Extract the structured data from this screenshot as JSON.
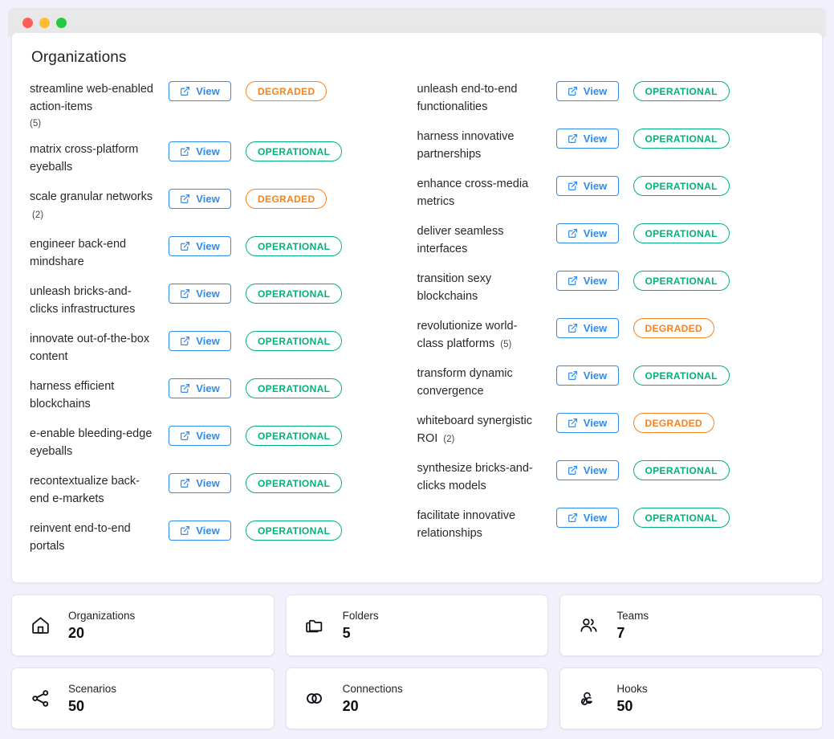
{
  "window": {
    "controls": [
      {
        "name": "close",
        "color": "#ff5f57"
      },
      {
        "name": "minimize",
        "color": "#febc2e"
      },
      {
        "name": "maximize",
        "color": "#28c840"
      }
    ]
  },
  "panel": {
    "title": "Organizations",
    "view_label": "View",
    "view_icon": "external-link-icon",
    "status_colors": {
      "operational": "#00b377",
      "degraded": "#f7821b"
    },
    "columns": [
      {
        "rows": [
          {
            "name": "streamline web-enabled action-items",
            "count": "(5)",
            "count_block": true,
            "status": "DEGRADED",
            "status_kind": "degraded"
          },
          {
            "name": "matrix cross-platform eyeballs",
            "count": "",
            "status": "OPERATIONAL",
            "status_kind": "operational"
          },
          {
            "name": "scale granular networks",
            "count": "(2)",
            "status": "DEGRADED",
            "status_kind": "degraded"
          },
          {
            "name": "engineer back-end mindshare",
            "count": "",
            "status": "OPERATIONAL",
            "status_kind": "operational"
          },
          {
            "name": "unleash bricks-and-clicks infrastructures",
            "count": "",
            "status": "OPERATIONAL",
            "status_kind": "operational"
          },
          {
            "name": "innovate out-of-the-box content",
            "count": "",
            "status": "OPERATIONAL",
            "status_kind": "operational"
          },
          {
            "name": "harness efficient blockchains",
            "count": "",
            "status": "OPERATIONAL",
            "status_kind": "operational"
          },
          {
            "name": "e-enable bleeding-edge eyeballs",
            "count": "",
            "status": "OPERATIONAL",
            "status_kind": "operational"
          },
          {
            "name": "recontextualize back-end e-markets",
            "count": "",
            "status": "OPERATIONAL",
            "status_kind": "operational"
          },
          {
            "name": "reinvent end-to-end portals",
            "count": "",
            "status": "OPERATIONAL",
            "status_kind": "operational"
          }
        ]
      },
      {
        "rows": [
          {
            "name": "unleash end-to-end functionalities",
            "count": "",
            "status": "OPERATIONAL",
            "status_kind": "operational"
          },
          {
            "name": "harness innovative partnerships",
            "count": "",
            "status": "OPERATIONAL",
            "status_kind": "operational"
          },
          {
            "name": "enhance cross-media metrics",
            "count": "",
            "status": "OPERATIONAL",
            "status_kind": "operational"
          },
          {
            "name": "deliver seamless interfaces",
            "count": "",
            "status": "OPERATIONAL",
            "status_kind": "operational"
          },
          {
            "name": "transition sexy blockchains",
            "count": "",
            "status": "OPERATIONAL",
            "status_kind": "operational"
          },
          {
            "name": "revolutionize world-class platforms",
            "count": "(5)",
            "status": "DEGRADED",
            "status_kind": "degraded"
          },
          {
            "name": "transform dynamic convergence",
            "count": "",
            "status": "OPERATIONAL",
            "status_kind": "operational"
          },
          {
            "name": "whiteboard synergistic ROI",
            "count": "(2)",
            "status": "DEGRADED",
            "status_kind": "degraded"
          },
          {
            "name": "synthesize bricks-and-clicks models",
            "count": "",
            "status": "OPERATIONAL",
            "status_kind": "operational"
          },
          {
            "name": "facilitate innovative relationships",
            "count": "",
            "status": "OPERATIONAL",
            "status_kind": "operational"
          }
        ]
      }
    ]
  },
  "stats": [
    {
      "label": "Organizations",
      "value": "20",
      "icon": "home-icon"
    },
    {
      "label": "Folders",
      "value": "5",
      "icon": "folders-icon"
    },
    {
      "label": "Teams",
      "value": "7",
      "icon": "users-icon"
    },
    {
      "label": "Scenarios",
      "value": "50",
      "icon": "share-nodes-icon"
    },
    {
      "label": "Connections",
      "value": "20",
      "icon": "linked-circles-icon"
    },
    {
      "label": "Hooks",
      "value": "50",
      "icon": "webhook-icon"
    }
  ]
}
